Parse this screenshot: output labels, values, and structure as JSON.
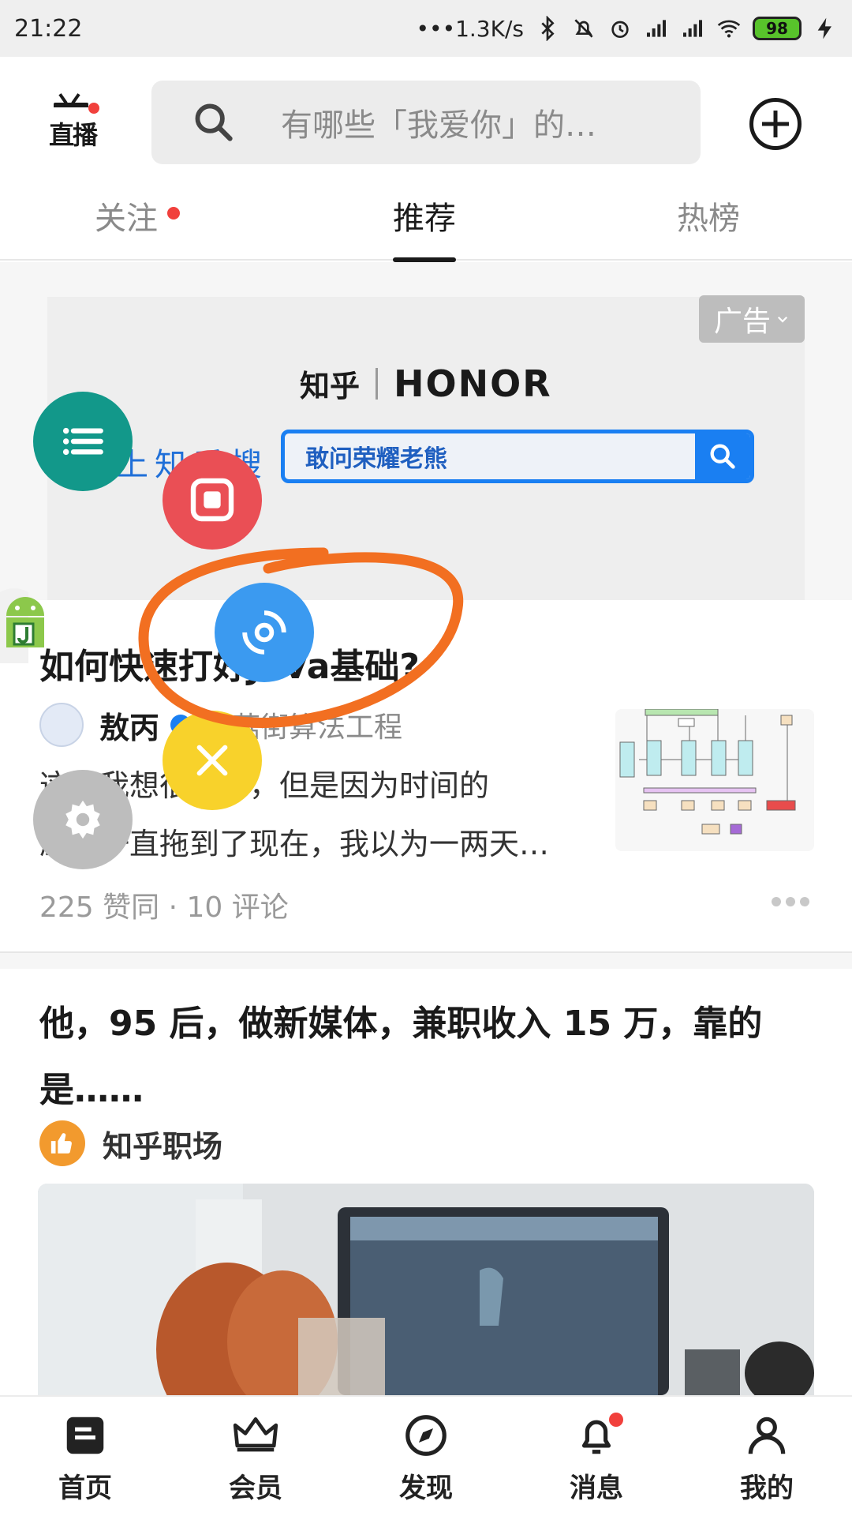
{
  "status_bar": {
    "time": "21:22",
    "network_speed": "•••1.3K/s",
    "battery": "98"
  },
  "header": {
    "live_label": "直播",
    "search_placeholder": "有哪些「我爱你」的…"
  },
  "tabs": [
    {
      "label": "关注",
      "has_dot": true
    },
    {
      "label": "推荐",
      "active": true
    },
    {
      "label": "热榜"
    }
  ],
  "ad": {
    "tag": "广告",
    "brand_left": "知乎",
    "brand_right": "HONOR",
    "search_label": "上知乎搜",
    "search_query": "敢问荣耀老熊"
  },
  "feed": [
    {
      "title": "如何快速打好Java基础?",
      "author": "敖丙",
      "author_title": "蘑菇街算法工程",
      "excerpt_line1": "这期我想很久了，但是因为时间的",
      "excerpt_line2": "原因一直拖到了现在，我以为一两天…",
      "meta": "225 赞同 · 10 评论"
    },
    {
      "title": "他，95 后，做新媒体，兼职收入 15 万，靠的是……",
      "source": "知乎职场"
    }
  ],
  "bottom_nav": [
    {
      "label": "首页",
      "icon": "home-icon"
    },
    {
      "label": "会员",
      "icon": "crown-icon"
    },
    {
      "label": "发现",
      "icon": "compass-icon"
    },
    {
      "label": "消息",
      "icon": "bell-icon",
      "badge": true
    },
    {
      "label": "我的",
      "icon": "person-icon"
    }
  ],
  "colors": {
    "accent_blue": "#1a7ff2",
    "badge_red": "#f1403c",
    "fab_teal": "#12988a",
    "fab_red": "#ea4f55",
    "fab_blue": "#3b9af0",
    "fab_yellow": "#f8d22b",
    "annotation_orange": "#f26f21"
  }
}
